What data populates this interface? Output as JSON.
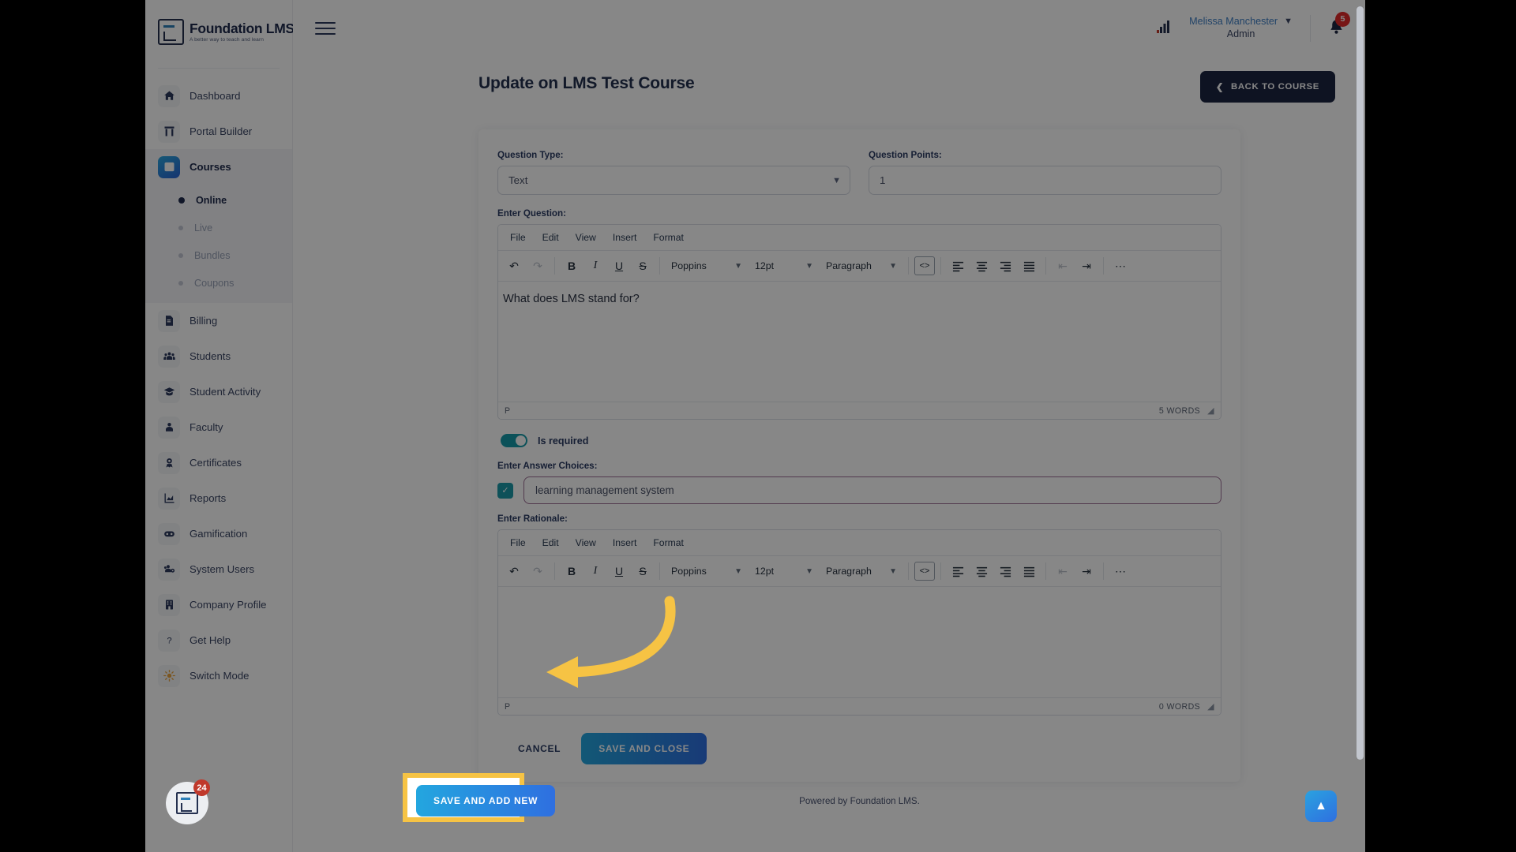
{
  "brand": {
    "name": "Foundation LMS®",
    "tagline": "A better way to teach and learn",
    "accent_blue": "#2b63d4",
    "accent_teal": "#169aa8",
    "dark": "#1c2540",
    "highlight_yellow": "#f6c344"
  },
  "topbar": {
    "hamburger_icon": "hamburger-icon",
    "chart_icon": "bar-chart-icon",
    "user_name": "Melissa Manchester",
    "user_role": "Admin",
    "chevron_icon": "chevron-down-icon",
    "bell_icon": "bell-icon",
    "notification_count": "5"
  },
  "sidebar": {
    "items": [
      {
        "label": "Dashboard",
        "icon": "home-icon",
        "active": false
      },
      {
        "label": "Portal Builder",
        "icon": "portal-icon",
        "active": false
      },
      {
        "label": "Courses",
        "icon": "book-icon",
        "active": true
      },
      {
        "label": "Billing",
        "icon": "invoice-icon",
        "active": false
      },
      {
        "label": "Students",
        "icon": "students-icon",
        "active": false
      },
      {
        "label": "Student Activity",
        "icon": "graduation-cap-icon",
        "active": false
      },
      {
        "label": "Faculty",
        "icon": "faculty-icon",
        "active": false
      },
      {
        "label": "Certificates",
        "icon": "certificate-icon",
        "active": false
      },
      {
        "label": "Reports",
        "icon": "reports-chart-icon",
        "active": false
      },
      {
        "label": "Gamification",
        "icon": "gamepad-icon",
        "active": false
      },
      {
        "label": "System Users",
        "icon": "system-users-icon",
        "active": false
      },
      {
        "label": "Company Profile",
        "icon": "building-icon",
        "active": false
      },
      {
        "label": "Get Help",
        "icon": "question-mark-icon",
        "active": false
      },
      {
        "label": "Switch Mode",
        "icon": "sun-icon",
        "active": false
      }
    ],
    "sub_items": [
      {
        "label": "Online",
        "active": true
      },
      {
        "label": "Live",
        "active": false
      },
      {
        "label": "Bundles",
        "active": false
      },
      {
        "label": "Coupons",
        "active": false
      }
    ]
  },
  "chat_widget": {
    "badge": "24",
    "icon": "foundation-lms-logo-icon"
  },
  "page": {
    "title": "Update on LMS Test Course",
    "back_button": "BACK TO COURSE",
    "back_icon": "chevron-left-icon",
    "footer": "Powered by Foundation LMS."
  },
  "form": {
    "question_type_label": "Question Type:",
    "question_type_value": "Text",
    "question_points_label": "Question Points:",
    "question_points_value": "1",
    "enter_question_label": "Enter Question:",
    "is_required_label": "Is required",
    "is_required_on": true,
    "answer_choices_label": "Enter Answer Choices:",
    "answer_choice_value": "learning management system",
    "answer_choice_checked": true,
    "rationale_label": "Enter Rationale:"
  },
  "editor_menus": [
    "File",
    "Edit",
    "View",
    "Insert",
    "Format"
  ],
  "editor_toolbar": {
    "undo_icon": "undo-icon",
    "redo_icon": "redo-icon",
    "bold": "B",
    "italic": "I",
    "underline": "U",
    "strikethrough": "S",
    "font_family": "Poppins",
    "font_size": "12pt",
    "block_format": "Paragraph",
    "source_code_icon": "source-code-icon",
    "align_left_icon": "align-left-icon",
    "align_center_icon": "align-center-icon",
    "align_right_icon": "align-right-icon",
    "align_justify_icon": "align-justify-icon",
    "outdent_icon": "outdent-icon",
    "indent_icon": "indent-icon",
    "more_icon": "ellipsis-icon"
  },
  "question_editor": {
    "content": "What does LMS stand for?",
    "status_path": "P",
    "word_count": "5 WORDS"
  },
  "rationale_editor": {
    "content": "",
    "status_path": "P",
    "word_count": "0 WORDS"
  },
  "actions": {
    "cancel": "CANCEL",
    "save_and_close": "SAVE AND CLOSE",
    "save_and_add_new": "SAVE AND ADD NEW"
  },
  "scroll_top": {
    "icon": "chevron-up-icon"
  }
}
